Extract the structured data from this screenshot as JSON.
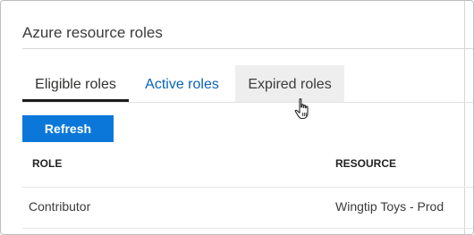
{
  "panel": {
    "title": "Azure resource roles"
  },
  "tabs": [
    {
      "label": "Eligible roles",
      "selected": true
    },
    {
      "label": "Active roles",
      "selected": false
    },
    {
      "label": "Expired roles",
      "selected": false,
      "hovered": true
    }
  ],
  "toolbar": {
    "refresh_label": "Refresh"
  },
  "table": {
    "columns": [
      "ROLE",
      "RESOURCE"
    ],
    "rows": [
      [
        "Contributor",
        "Wingtip Toys - Prod"
      ]
    ]
  },
  "cursor": {
    "icon": "hand-pointer-icon"
  },
  "colors": {
    "accent": "#0b78d9",
    "link": "#0a63b5",
    "selected_underline": "#1b1b1b",
    "hover_bg": "#eeeeee"
  }
}
